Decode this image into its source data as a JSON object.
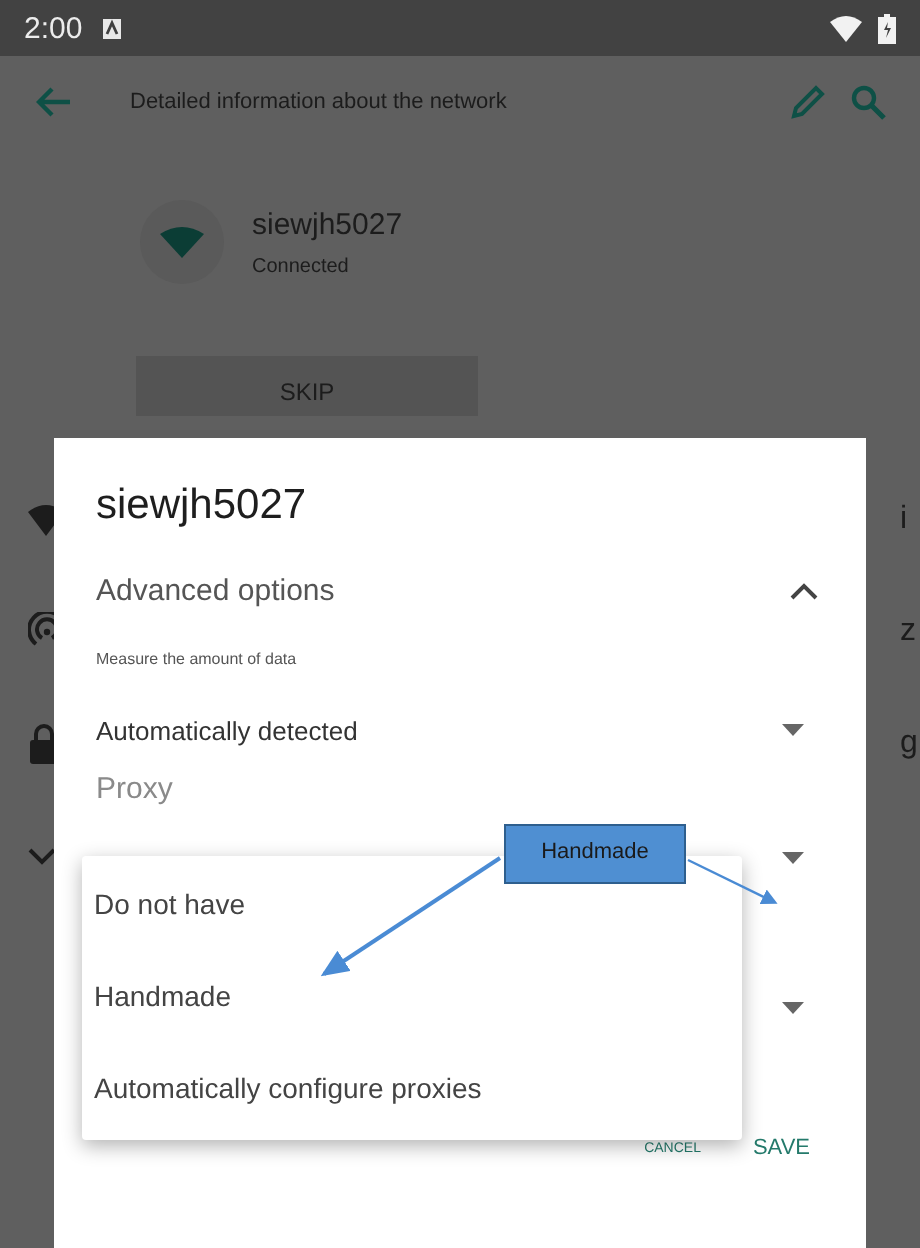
{
  "status_bar": {
    "time": "2:00"
  },
  "app_bar": {
    "title": "Detailed information about the network"
  },
  "network": {
    "name": "siewjh5027",
    "status": "Connected"
  },
  "skip_button": "SKIP",
  "background_rows": [
    {
      "kind": "wifi",
      "text_end": "i"
    },
    {
      "kind": "hotspot",
      "text_end": "z"
    },
    {
      "kind": "lock",
      "text_end": "g"
    },
    {
      "kind": "expand"
    }
  ],
  "dialog": {
    "title": "siewjh5027",
    "section": {
      "label": "Advanced options",
      "expanded": true
    },
    "data_label": "Measure the amount of data",
    "data_value": "Automatically detected",
    "proxy_label": "Proxy",
    "buttons": [
      {
        "label": "CANCEL",
        "kind": "small"
      },
      {
        "label": "SAVE",
        "kind": "primary"
      }
    ]
  },
  "dropdown": {
    "options": [
      {
        "label": "Do not have",
        "selected": false
      },
      {
        "label": "Handmade",
        "selected": false
      },
      {
        "label": "Automatically configure proxies",
        "selected": false
      }
    ]
  },
  "annotation": {
    "label": "Handmade"
  }
}
